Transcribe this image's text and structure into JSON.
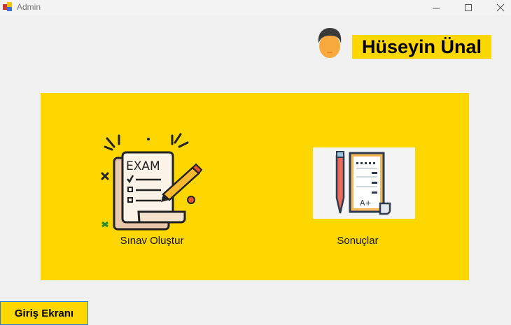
{
  "window": {
    "title": "Admin",
    "controls": [
      "minimize",
      "maximize",
      "close"
    ]
  },
  "user": {
    "name": "Hüseyin Ünal",
    "avatar_icon": "man-avatar-icon"
  },
  "menu": {
    "items": [
      {
        "label": "Sınav Oluştur",
        "icon": "exam-icon",
        "image_text": "EXAM"
      },
      {
        "label": "Sonuçlar",
        "icon": "results-icon",
        "image_text": "A+"
      }
    ]
  },
  "footer": {
    "login_button": "Giriş Ekranı"
  },
  "colors": {
    "accent": "#FFD700",
    "background": "#F0F0F0"
  }
}
